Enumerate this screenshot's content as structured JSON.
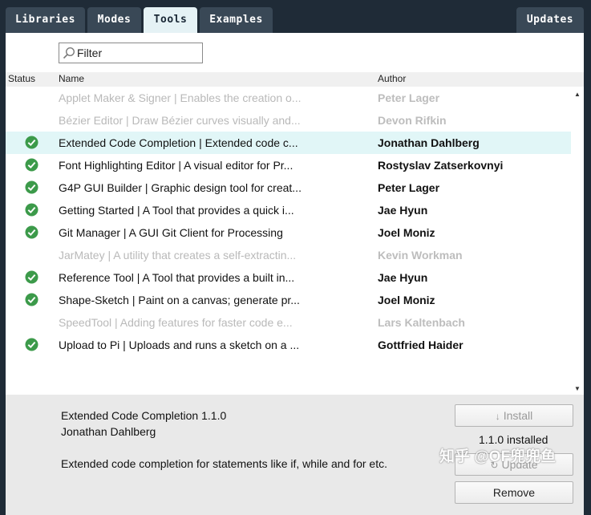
{
  "tabs": [
    {
      "label": "Libraries"
    },
    {
      "label": "Modes"
    },
    {
      "label": "Tools"
    },
    {
      "label": "Examples"
    }
  ],
  "updates_tab": {
    "label": "Updates"
  },
  "filter": {
    "placeholder": "Filter",
    "icon": "search-icon"
  },
  "columns": {
    "status": "Status",
    "name": "Name",
    "author": "Author"
  },
  "rows": [
    {
      "name": "Applet Maker & Signer | Enables the creation o...",
      "author": "Peter Lager",
      "installed": false
    },
    {
      "name": "Bézier Editor | Draw Bézier curves visually and...",
      "author": "Devon Rifkin",
      "installed": false
    },
    {
      "name": "Extended Code Completion | Extended code c...",
      "author": "Jonathan Dahlberg",
      "installed": true,
      "selected": true
    },
    {
      "name": "Font Highlighting Editor | A visual editor for Pr...",
      "author": "Rostyslav Zatserkovnyi",
      "installed": true
    },
    {
      "name": "G4P GUI Builder | Graphic design tool for creat...",
      "author": "Peter Lager",
      "installed": true
    },
    {
      "name": "Getting Started | A Tool that provides a quick i...",
      "author": "Jae Hyun",
      "installed": true
    },
    {
      "name": "Git Manager | A GUI Git Client for Processing",
      "author": "Joel Moniz",
      "installed": true
    },
    {
      "name": "JarMatey | A utility that creates a self-extractin...",
      "author": "Kevin Workman",
      "installed": false
    },
    {
      "name": "Reference Tool | A Tool that provides a built in...",
      "author": "Jae Hyun",
      "installed": true
    },
    {
      "name": "Shape-Sketch | Paint on a canvas; generate pr...",
      "author": "Joel Moniz",
      "installed": true
    },
    {
      "name": "SpeedTool | Adding features for faster code e...",
      "author": "Lars Kaltenbach",
      "installed": false
    },
    {
      "name": "Upload to Pi | Uploads and runs a sketch on a ...",
      "author": "Gottfried Haider",
      "installed": true
    }
  ],
  "details": {
    "title": "Extended Code Completion 1.1.0",
    "author": "Jonathan Dahlberg",
    "description": "Extended code completion for statements like if, while and for etc.",
    "installed_version": "1.1.0 installed",
    "install_label": "Install",
    "update_label": "Update",
    "remove_label": "Remove"
  },
  "watermark": "知乎 @OF兜兜鱼",
  "colors": {
    "tab_bg": "#394856",
    "active_tab_bg": "#e5f2f5",
    "selected_row": "#e1f6f7",
    "check_green": "#3c9a4a"
  }
}
